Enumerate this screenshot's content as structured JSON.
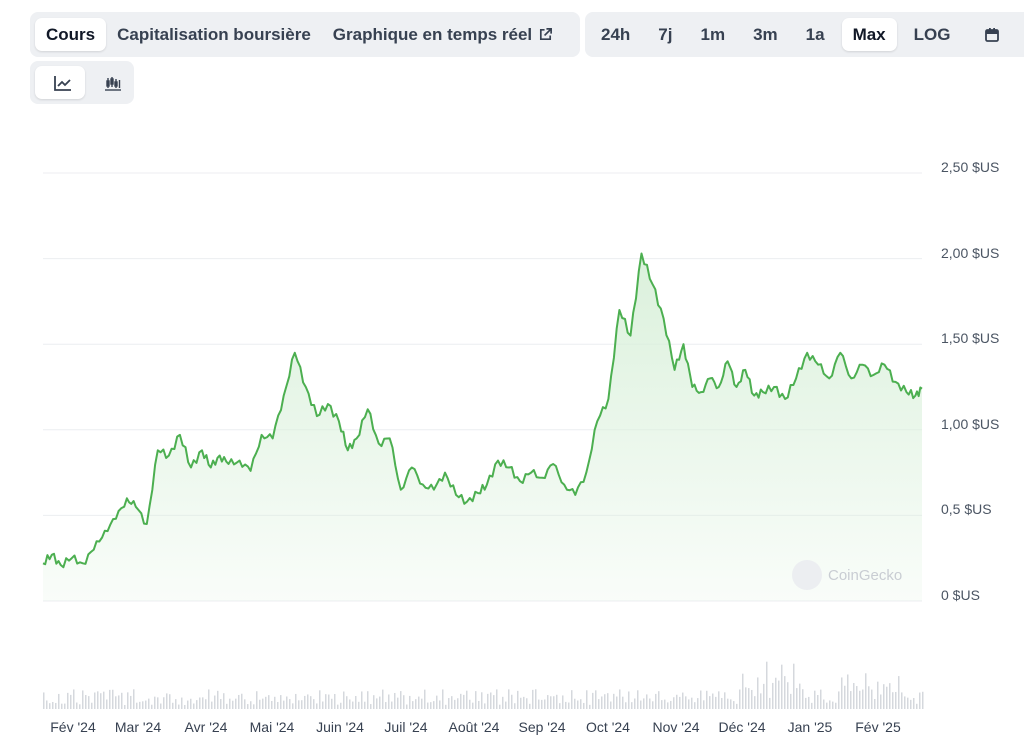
{
  "tabs": [
    {
      "label": "Cours",
      "active": true
    },
    {
      "label": "Capitalisation boursière",
      "active": false
    },
    {
      "label": "Graphique en temps réel",
      "active": false,
      "icon": "external-link-icon"
    }
  ],
  "ranges": [
    {
      "label": "24h",
      "active": false
    },
    {
      "label": "7j",
      "active": false
    },
    {
      "label": "1m",
      "active": false
    },
    {
      "label": "3m",
      "active": false
    },
    {
      "label": "1a",
      "active": false
    },
    {
      "label": "Max",
      "active": true
    },
    {
      "label": "LOG",
      "active": false
    }
  ],
  "icons": {
    "calendar": "calendar-icon",
    "line": "line-chart-icon",
    "candle": "candlestick-icon"
  },
  "watermark": "CoinGecko",
  "colors": {
    "line": "#4caf50",
    "fill_top": "#d9f0da",
    "volume": "#d5d8dd",
    "grid": "#eceef1"
  },
  "chart_data": {
    "type": "area",
    "y_tick_labels": [
      "2,50 $US",
      "2,00 $US",
      "1,50 $US",
      "1,00 $US",
      "0,5 $US",
      "0 $US"
    ],
    "y_ticks": [
      2.5,
      2.0,
      1.5,
      1.0,
      0.5,
      0
    ],
    "ylim": [
      0,
      2.5
    ],
    "x_tick_labels": [
      "Fév '24",
      "Mar '24",
      "Avr '24",
      "Mai '24",
      "Juin '24",
      "Juil '24",
      "Août '24",
      "Sep '24",
      "Oct '24",
      "Nov '24",
      "Déc '24",
      "Jan '25",
      "Fév '25"
    ],
    "x_range": [
      "2024-01-20",
      "2025-02-21"
    ],
    "x_ticks": [
      "2024-02-01",
      "2024-03-01",
      "2024-04-01",
      "2024-05-01",
      "2024-06-01",
      "2024-07-01",
      "2024-08-01",
      "2024-09-01",
      "2024-10-01",
      "2024-11-01",
      "2024-12-01",
      "2025-01-01",
      "2025-02-01"
    ],
    "series": [
      {
        "x": [
          "2024-01-20",
          "2024-01-24",
          "2024-01-28",
          "2024-02-02",
          "2024-02-07",
          "2024-02-12",
          "2024-02-17",
          "2024-02-22",
          "2024-02-27",
          "2024-03-02",
          "2024-03-07",
          "2024-03-12",
          "2024-03-17",
          "2024-03-22",
          "2024-03-27",
          "2024-04-01",
          "2024-04-05",
          "2024-04-09",
          "2024-04-13",
          "2024-04-18",
          "2024-04-23",
          "2024-04-28",
          "2024-05-03",
          "2024-05-08",
          "2024-05-13",
          "2024-05-18",
          "2024-05-23",
          "2024-05-28",
          "2024-06-02",
          "2024-06-06",
          "2024-06-10",
          "2024-06-15",
          "2024-06-20",
          "2024-06-25",
          "2024-06-30",
          "2024-07-05",
          "2024-07-10",
          "2024-07-15",
          "2024-07-20",
          "2024-07-25",
          "2024-07-30",
          "2024-08-04",
          "2024-08-08",
          "2024-08-13",
          "2024-08-18",
          "2024-08-23",
          "2024-08-28",
          "2024-09-02",
          "2024-09-07",
          "2024-09-12",
          "2024-09-17",
          "2024-09-22",
          "2024-09-27",
          "2024-10-02",
          "2024-10-07",
          "2024-10-12",
          "2024-10-17",
          "2024-10-22",
          "2024-10-27",
          "2024-11-01",
          "2024-11-05",
          "2024-11-09",
          "2024-11-13",
          "2024-11-17",
          "2024-11-21",
          "2024-11-25",
          "2024-11-29",
          "2024-12-03",
          "2024-12-07",
          "2024-12-11",
          "2024-12-16",
          "2024-12-21",
          "2024-12-26",
          "2024-12-31",
          "2025-01-05",
          "2025-01-10",
          "2025-01-15",
          "2025-01-20",
          "2025-01-25",
          "2025-01-30",
          "2025-02-04",
          "2025-02-09",
          "2025-02-14",
          "2025-02-18",
          "2025-02-21"
        ],
        "values": [
          0.22,
          0.27,
          0.21,
          0.25,
          0.22,
          0.3,
          0.41,
          0.48,
          0.6,
          0.55,
          0.45,
          0.88,
          0.85,
          0.97,
          0.78,
          0.88,
          0.78,
          0.85,
          0.8,
          0.82,
          0.76,
          0.97,
          0.95,
          1.2,
          1.45,
          1.25,
          1.08,
          1.15,
          1.05,
          0.88,
          0.95,
          1.12,
          0.92,
          0.95,
          0.65,
          0.78,
          0.68,
          0.65,
          0.75,
          0.62,
          0.58,
          0.63,
          0.68,
          0.82,
          0.78,
          0.7,
          0.75,
          0.72,
          0.8,
          0.68,
          0.62,
          0.75,
          1.05,
          1.18,
          1.7,
          1.55,
          2.03,
          1.85,
          1.65,
          1.35,
          1.5,
          1.25,
          1.22,
          1.3,
          1.25,
          1.4,
          1.25,
          1.35,
          1.2,
          1.22,
          1.25,
          1.18,
          1.3,
          1.45,
          1.38,
          1.3,
          1.45,
          1.3,
          1.38,
          1.32,
          1.38,
          1.28,
          1.22,
          1.2,
          1.24
        ]
      }
    ]
  }
}
